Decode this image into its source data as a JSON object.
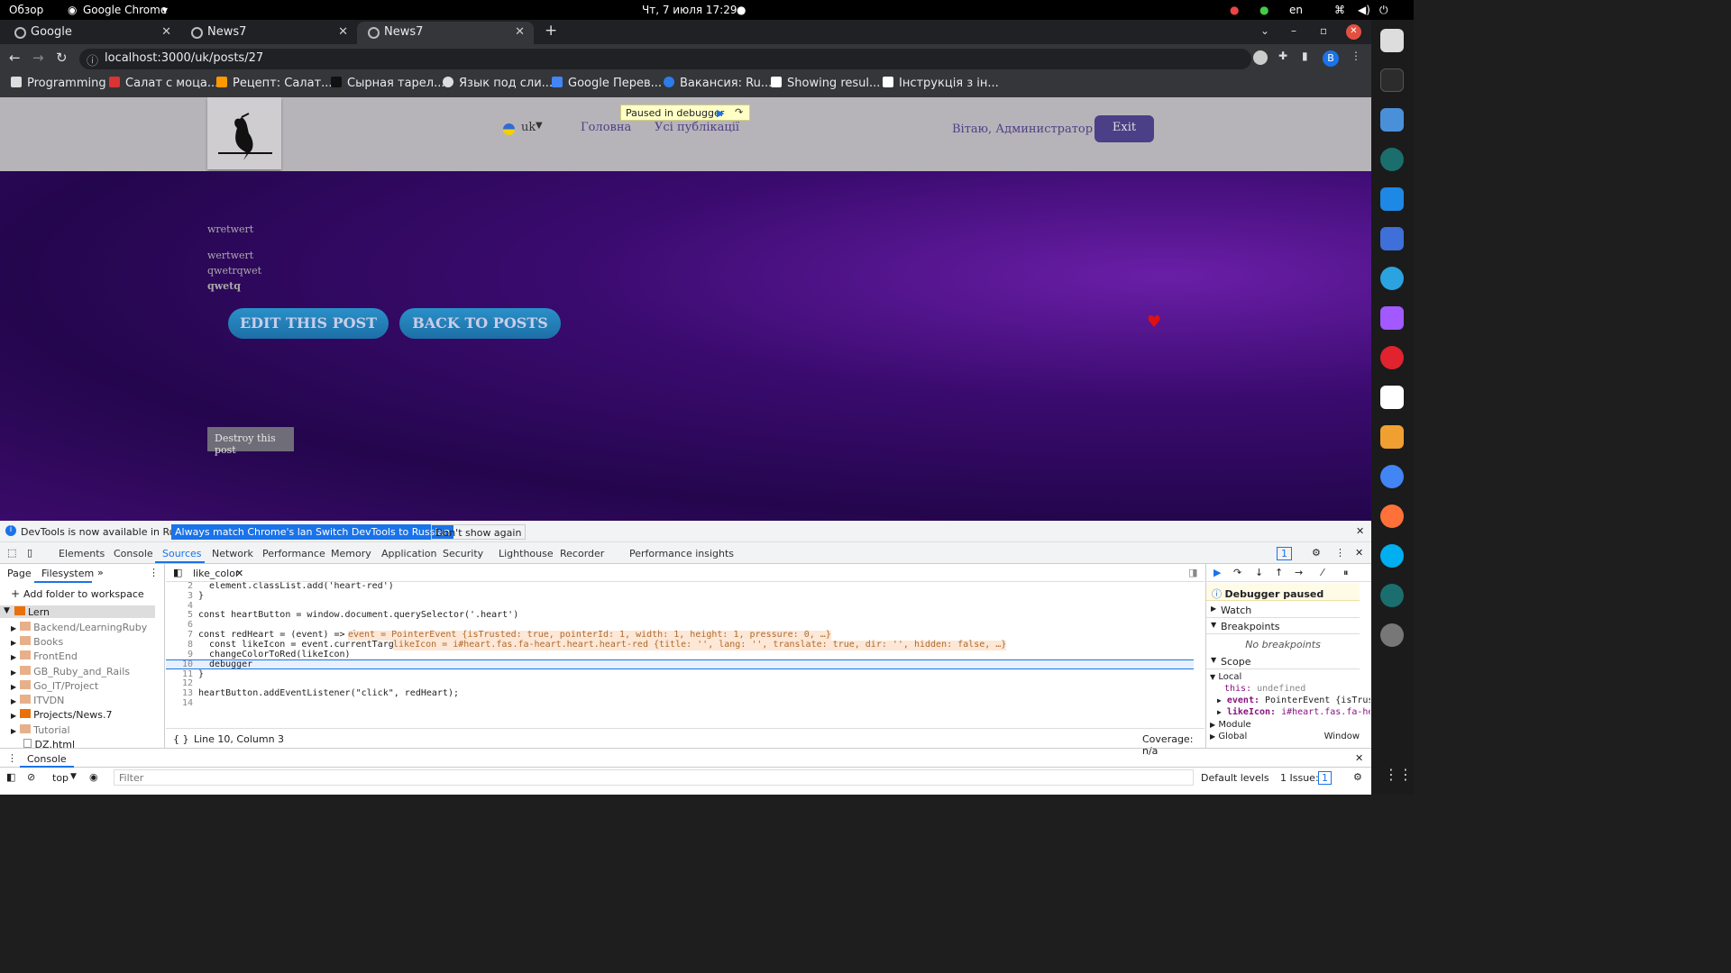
{
  "system": {
    "activities": "Обзор",
    "app_name": "Google Chrome",
    "datetime": "Чт, 7 июля  17:29",
    "lang": "en"
  },
  "tabs": [
    {
      "label": "Google"
    },
    {
      "label": "News7"
    },
    {
      "label": "News7"
    }
  ],
  "address": {
    "url": "localhost:3000/uk/posts/27"
  },
  "profile_initial": "B",
  "bookmarks": [
    "Programming",
    "Салат с моца...",
    "Рецепт: Салат...",
    "Сырная тарел...",
    "Язык под сли...",
    "Google Перев...",
    "Вакансия: Ru...",
    "Showing resul...",
    "Інструкція з ін..."
  ],
  "site": {
    "lang": "uk",
    "nav": [
      "Головна",
      "Усі публікації"
    ],
    "greeting": "Вітаю, Администратор",
    "exit": "Exit",
    "paused_banner": "Paused in debugger",
    "post": {
      "title": "wretwert",
      "lines": [
        "wertwert",
        "qwetrqwet"
      ],
      "bold": "qwetq"
    },
    "edit_button": "EDIT THIS POST",
    "back_button": "BACK TO POSTS",
    "destroy_button": "Destroy this post"
  },
  "devtools": {
    "info": "DevTools is now available in Russian!",
    "btn_match": "Always match Chrome's language",
    "btn_switch": "Switch DevTools to Russian",
    "btn_dont": "Don't show again",
    "tabs": [
      "Elements",
      "Console",
      "Sources",
      "Network",
      "Performance",
      "Memory",
      "Application",
      "Security",
      "Lighthouse",
      "Recorder",
      "Performance insights"
    ],
    "issues_badge": "1",
    "nav_tabs": [
      "Page",
      "Filesystem"
    ],
    "add_folder": "Add folder to workspace",
    "tree": [
      "Lern",
      "Backend/LearningRuby",
      "Books",
      "FrontEnd",
      "GB_Ruby_and_Rails",
      "Go_IT/Project",
      "ITVDN",
      "Projects/News.7",
      "Tutorial",
      "DZ.html"
    ],
    "file_tab": "like_color",
    "code": [
      {
        "n": "2",
        "t": "  element.classList.add('heart-red')"
      },
      {
        "n": "3",
        "t": "}"
      },
      {
        "n": "4",
        "t": ""
      },
      {
        "n": "5",
        "t": "const heartButton = window.document.querySelector('.heart')"
      },
      {
        "n": "6",
        "t": ""
      },
      {
        "n": "7",
        "t": "const redHeart = (event) => {",
        "hint": "event = PointerEvent {isTrusted: true, pointerId: 1, width: 1, height: 1, pressure: 0, …}"
      },
      {
        "n": "8",
        "t": "  const likeIcon = event.currentTarget",
        "hint": "likeIcon = i#heart.fas.fa-heart.heart.heart-red {title: '', lang: '', translate: true, dir: '', hidden: false, …}"
      },
      {
        "n": "9",
        "t": "  changeColorToRed(likeIcon)"
      },
      {
        "n": "10",
        "t": "  debugger"
      },
      {
        "n": "11",
        "t": "}"
      },
      {
        "n": "12",
        "t": ""
      },
      {
        "n": "13",
        "t": "heartButton.addEventListener(\"click\", redHeart);"
      },
      {
        "n": "14",
        "t": ""
      }
    ],
    "status": "Line 10, Column 3",
    "coverage": "Coverage: n/a",
    "debugger_paused": "Debugger paused",
    "sections": {
      "watch": "Watch",
      "breakpoints": "Breakpoints",
      "no_bp": "No breakpoints",
      "scope": "Scope",
      "local": "Local",
      "module": "Module",
      "global": "Global",
      "global_val": "Window"
    },
    "scope_rows": [
      {
        "k": "this:",
        "v": "undefined"
      },
      {
        "k": "event:",
        "v": "PointerEvent {isTrust"
      },
      {
        "k": "likeIcon:",
        "v": "i#heart.fas.fa-hea"
      }
    ],
    "console_tab": "Console",
    "context": "top",
    "filter_ph": "Filter",
    "levels": "Default levels",
    "issue": "1 Issue:"
  }
}
